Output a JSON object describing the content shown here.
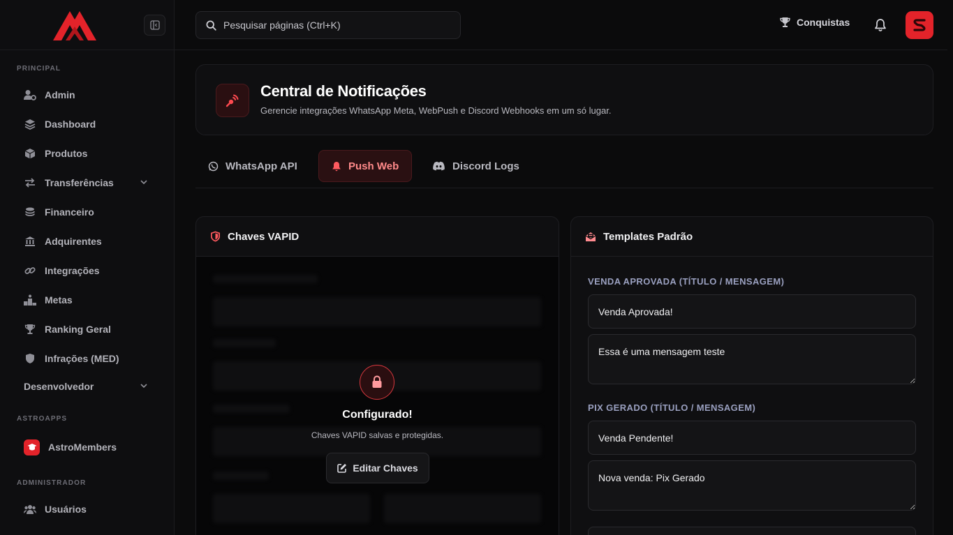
{
  "sidebar": {
    "sections": {
      "principal": "PRINCIPAL",
      "astroapps": "ASTROAPPS",
      "administrador": "ADMINISTRADOR"
    },
    "items": [
      {
        "label": "Admin",
        "icon": "user-gear-icon"
      },
      {
        "label": "Dashboard",
        "icon": "layers-icon"
      },
      {
        "label": "Produtos",
        "icon": "box-icon"
      },
      {
        "label": "Transferências",
        "icon": "arrows-exchange-icon"
      },
      {
        "label": "Financeiro",
        "icon": "coins-icon"
      },
      {
        "label": "Adquirentes",
        "icon": "bank-icon"
      },
      {
        "label": "Integrações",
        "icon": "link-icon"
      },
      {
        "label": "Metas",
        "icon": "podium-icon"
      },
      {
        "label": "Ranking Geral",
        "icon": "trophy-icon"
      },
      {
        "label": "Infrações (MED)",
        "icon": "shield-icon"
      }
    ],
    "developer_label": "Desenvolvedor",
    "astro_members_label": "AstroMembers",
    "users_label": "Usuários"
  },
  "header": {
    "search_placeholder": "Pesquisar páginas (Ctrl+K)",
    "achievements_label": "Conquistas"
  },
  "hero": {
    "title": "Central de Notificações",
    "subtitle": "Gerencie integrações WhatsApp Meta, WebPush e Discord Webhooks em um só lugar."
  },
  "tabs": [
    {
      "label": "WhatsApp API",
      "active": false
    },
    {
      "label": "Push Web",
      "active": true
    },
    {
      "label": "Discord Logs",
      "active": false
    }
  ],
  "vapid": {
    "title": "Chaves VAPID",
    "status_title": "Configurado!",
    "status_sub": "Chaves VAPID salvas e protegidas.",
    "edit_label": "Editar Chaves"
  },
  "templates": {
    "title": "Templates Padrão",
    "groups": [
      {
        "label": "VENDA APROVADA (TÍTULO / MENSAGEM)",
        "title_value": "Venda Aprovada!",
        "message_value": "Essa é uma mensagem teste"
      },
      {
        "label": "PIX GERADO (TÍTULO / MENSAGEM)",
        "title_value": "Venda Pendente!",
        "message_value": "Nova venda: Pix Gerado"
      }
    ]
  },
  "colors": {
    "accent": "#e3232a",
    "background": "#0b0b0c",
    "panel": "#0f0f11"
  }
}
